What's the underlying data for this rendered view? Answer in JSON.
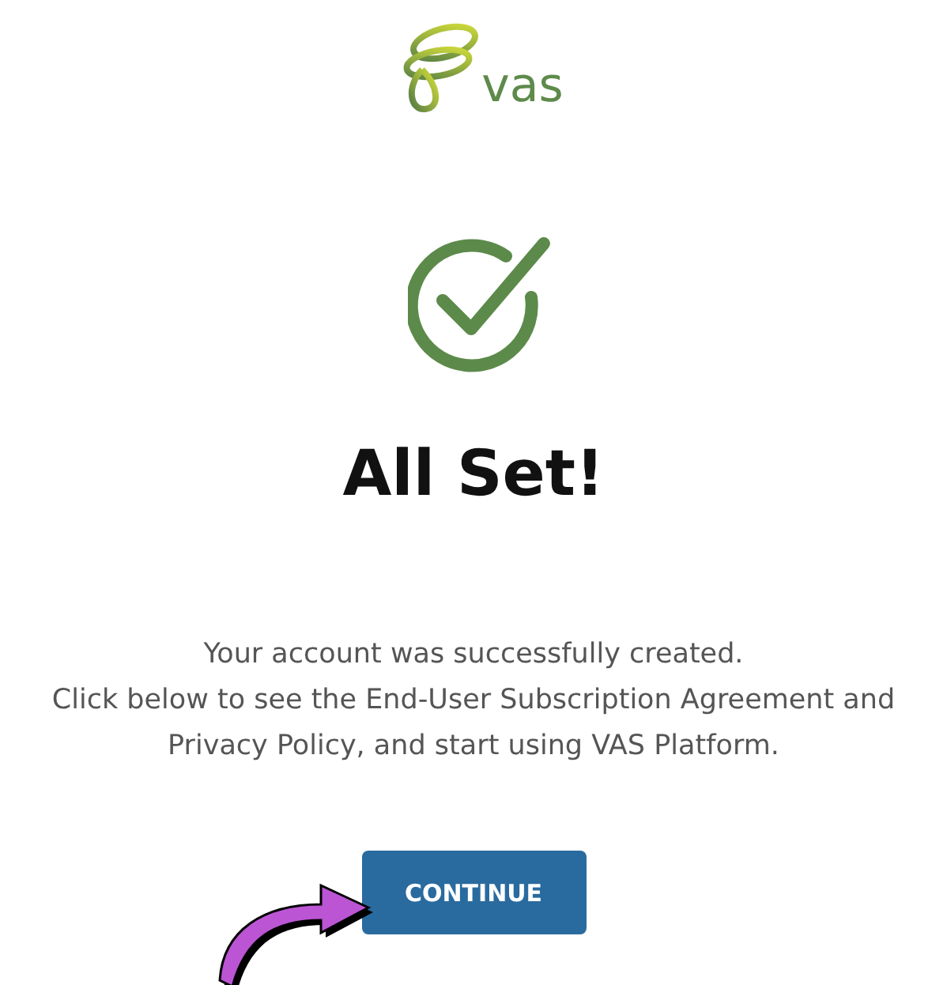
{
  "logo": {
    "text": "vas"
  },
  "title": "All Set!",
  "message": [
    "Your account was successfully created.",
    "Click below to see the End-User Subscription Agreement and Privacy Policy, and start using VAS Platform."
  ],
  "button": {
    "label": "CONTINUE"
  }
}
